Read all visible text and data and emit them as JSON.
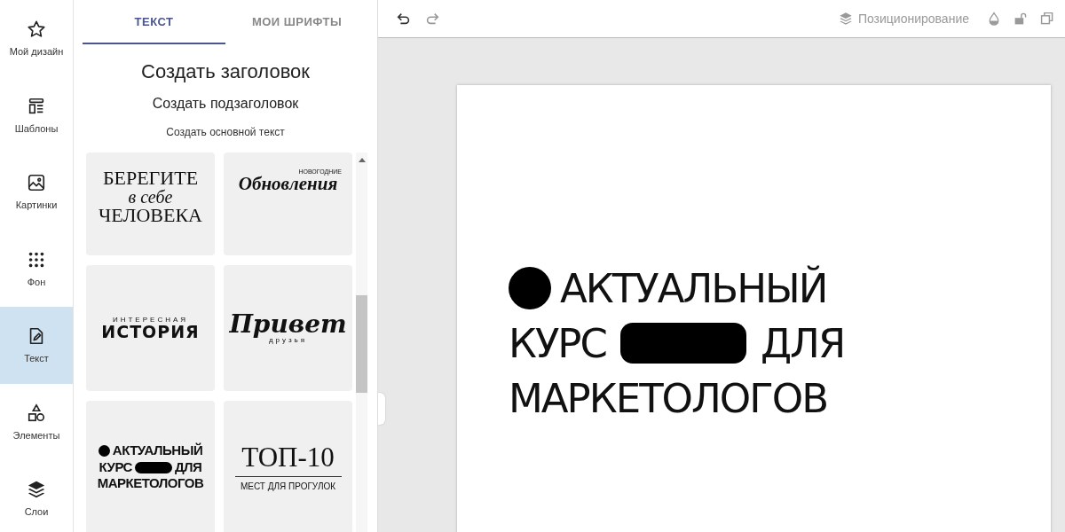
{
  "sidebar": {
    "items": [
      {
        "label": "Мой дизайн",
        "selected": false
      },
      {
        "label": "Шаблоны",
        "selected": false
      },
      {
        "label": "Картинки",
        "selected": false
      },
      {
        "label": "Фон",
        "selected": false
      },
      {
        "label": "Текст",
        "selected": true
      },
      {
        "label": "Элементы",
        "selected": false
      },
      {
        "label": "Слои",
        "selected": false
      }
    ]
  },
  "panel": {
    "tabs": [
      {
        "label": "ТЕКСТ",
        "selected": true
      },
      {
        "label": "МОИ ШРИФТЫ",
        "selected": false
      }
    ],
    "heading": "Создать заголовок",
    "subheading": "Создать подзаголовок",
    "body_text": "Создать основной текст",
    "templates": [
      {
        "lines": [
          [
            {
              "kind": "serif-caps",
              "text": "БЕРЕГИТЕ"
            }
          ],
          [
            {
              "kind": "serif-italic",
              "text": "в себе"
            }
          ],
          [
            {
              "kind": "serif-caps",
              "text": "ЧЕЛОВЕКА"
            }
          ]
        ]
      },
      {
        "lines": [
          [
            {
              "kind": "tiny-right",
              "text": "НОВОГОДНИЕ"
            }
          ],
          [
            {
              "kind": "serif-bold-italic",
              "text": "Обновления"
            }
          ]
        ]
      },
      {
        "lines": [
          [
            {
              "kind": "spaced-small",
              "text": "ИНТЕРЕСНАЯ"
            }
          ],
          [
            {
              "kind": "heavy",
              "text": "ИСТОРИЯ"
            }
          ]
        ]
      },
      {
        "lines": [
          [
            {
              "kind": "script",
              "text": "Привет"
            }
          ],
          [
            {
              "kind": "spaced-small",
              "text": "друзья"
            }
          ]
        ]
      },
      {
        "lines": [
          [
            {
              "kind": "dot"
            },
            {
              "kind": "sans",
              "text": "АКТУАЛЬНЫЙ"
            }
          ],
          [
            {
              "kind": "sans",
              "text": "КУРС"
            },
            {
              "kind": "pill"
            },
            {
              "kind": "sans",
              "text": "ДЛЯ"
            }
          ],
          [
            {
              "kind": "sans",
              "text": "МАРКЕТОЛОГОВ"
            }
          ]
        ]
      },
      {
        "lines": [
          [
            {
              "kind": "serif-big",
              "text": "ТОП-10"
            }
          ],
          [
            {
              "kind": "rule"
            }
          ],
          [
            {
              "kind": "sans-small",
              "text": "МЕСТ ДЛЯ ПРОГУЛОК"
            }
          ]
        ]
      }
    ]
  },
  "toolbar": {
    "positioning": "Позиционирование"
  },
  "canvas": {
    "lines": [
      [
        {
          "kind": "dot"
        },
        {
          "kind": "text",
          "text": "АКТУАЛЬНЫЙ"
        }
      ],
      [
        {
          "kind": "text",
          "text": "КУРС"
        },
        {
          "kind": "pill"
        },
        {
          "kind": "text",
          "text": "ДЛЯ"
        }
      ],
      [
        {
          "kind": "text",
          "text": "МАРКЕТОЛОГОВ"
        }
      ]
    ]
  }
}
